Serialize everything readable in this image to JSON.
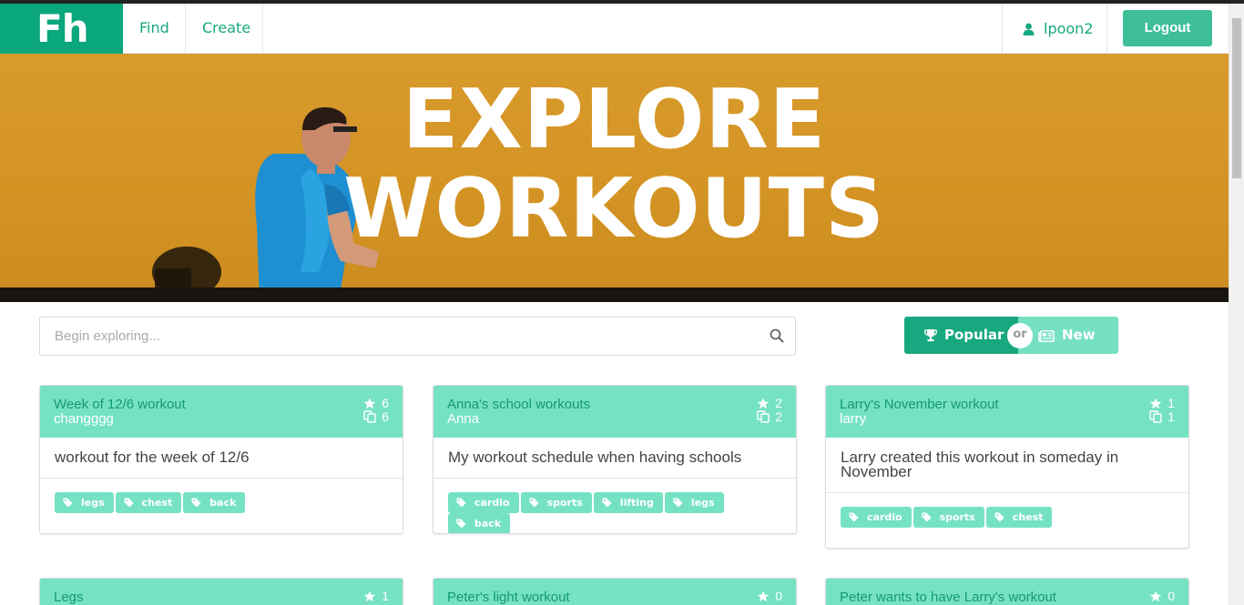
{
  "nav": {
    "brand": "Fh",
    "find": "Find",
    "create": "Create",
    "username": "lpoon2",
    "logout": "Logout"
  },
  "hero": {
    "title_line1": "EXPLORE",
    "title_line2": "WORKOUTS"
  },
  "search": {
    "placeholder": "Begin exploring..."
  },
  "sort": {
    "popular": "Popular",
    "or": "or",
    "new": "New"
  },
  "colors": {
    "brand": "#0aa67c",
    "accent": "#18a87f",
    "card_header": "#76e2c4"
  },
  "cards": [
    {
      "title": "Week of 12/6 workout",
      "author": "changggg",
      "stars": "6",
      "copies": "6",
      "description": "workout for the week of 12/6",
      "tags": [
        "legs",
        "chest",
        "back"
      ]
    },
    {
      "title": "Anna's school workouts",
      "author": "Anna",
      "stars": "2",
      "copies": "2",
      "description": "My workout schedule when having schools",
      "tags": [
        "cardio",
        "sports",
        "lifting",
        "legs",
        "back"
      ]
    },
    {
      "title": "Larry's November workout",
      "author": "larry",
      "stars": "1",
      "copies": "1",
      "description": "Larry created this workout in someday in November",
      "tags": [
        "cardio",
        "sports",
        "chest"
      ]
    },
    {
      "title": "Legs",
      "stars": "1"
    },
    {
      "title": "Peter's light workout",
      "stars": "0"
    },
    {
      "title": "Peter wants to have Larry's workout",
      "stars": "0"
    }
  ]
}
